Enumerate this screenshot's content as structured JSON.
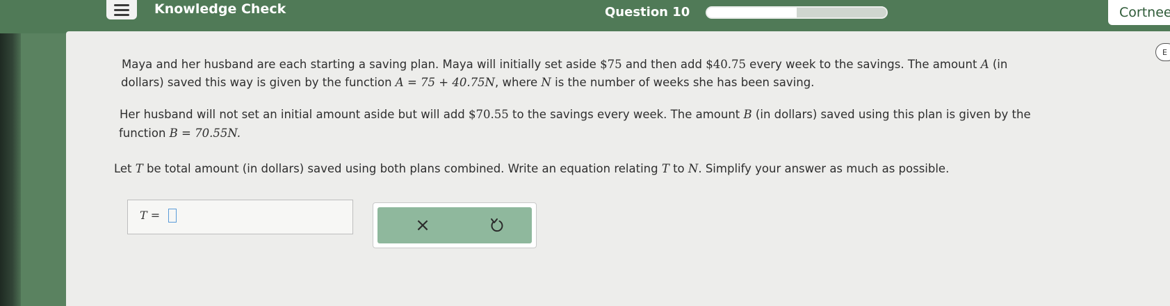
{
  "header": {
    "title": "Knowledge Check",
    "question": "Question 10",
    "progress": 0.5,
    "user_name": "Cortnee"
  },
  "side_badge": "E",
  "problem": {
    "p1_line1_a": "Maya and her husband are each starting a saving plan. Maya will initially set aside ",
    "p1_amount1": "$75",
    "p1_line1_b": " and then add ",
    "p1_amount2": "$40.75",
    "p1_line1_c": " every week to the savings. The amount ",
    "p1_var_a": "A",
    "p1_line1_d": " (in",
    "p1_line2_a": "dollars) saved this way is given by the function ",
    "p1_func": "A = 75 + 40.75N",
    "p1_line2_b": ", where ",
    "p1_var_n": "N",
    "p1_line2_c": " is the number of weeks she has been saving.",
    "p2_line1_a": "Her husband will not set an initial amount aside but will add ",
    "p2_amount": "$70.55",
    "p2_line1_b": " to the savings every week. The amount ",
    "p2_var_b": "B",
    "p2_line1_c": " (in dollars) saved using this plan is given by the",
    "p2_line2_a": "function ",
    "p2_func": "B = 70.55N.",
    "p3_a": "Let ",
    "p3_var_t": "T",
    "p3_b": " be total amount (in dollars) saved using both plans combined. Write an equation relating ",
    "p3_var_t2": "T",
    "p3_c": " to ",
    "p3_var_n": "N",
    "p3_d": ". Simplify your answer as much as possible."
  },
  "answer": {
    "label": "T =",
    "value": ""
  },
  "actions": {
    "clear_symbol": "×",
    "undo_icon": "undo-icon"
  }
}
